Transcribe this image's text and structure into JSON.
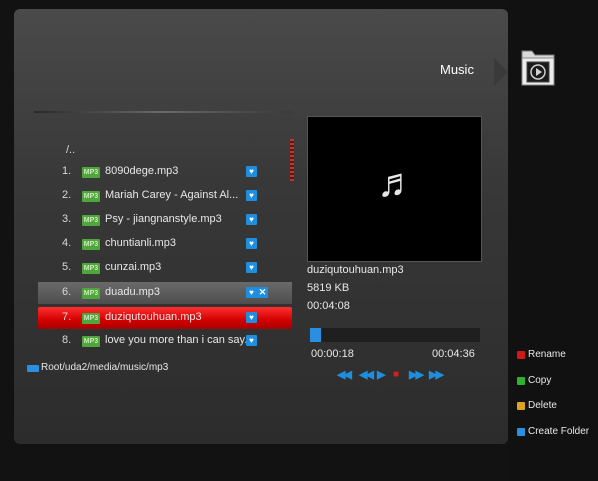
{
  "header": {
    "title": "Music",
    "icon": "music-folder-icon"
  },
  "file_list": {
    "parent": "/..",
    "items": [
      {
        "num": "1.",
        "type": "MP3",
        "name": "8090dege.mp3",
        "fav": true,
        "del": false,
        "state": "normal"
      },
      {
        "num": "2.",
        "type": "MP3",
        "name": "Mariah Carey - Against Al...",
        "fav": true,
        "del": false,
        "state": "normal"
      },
      {
        "num": "3.",
        "type": "MP3",
        "name": "Psy - jiangnanstyle.mp3",
        "fav": true,
        "del": false,
        "state": "normal"
      },
      {
        "num": "4.",
        "type": "MP3",
        "name": "chuntianli.mp3",
        "fav": true,
        "del": false,
        "state": "normal"
      },
      {
        "num": "5.",
        "type": "MP3",
        "name": "cunzai.mp3",
        "fav": true,
        "del": false,
        "state": "normal"
      },
      {
        "num": "6.",
        "type": "MP3",
        "name": "duadu.mp3",
        "fav": true,
        "del": true,
        "state": "selected"
      },
      {
        "num": "7.",
        "type": "MP3",
        "name": "duziqutouhuan.mp3",
        "fav": true,
        "del": false,
        "state": "highlighted"
      },
      {
        "num": "8.",
        "type": "MP3",
        "name": "love you more than i can say.",
        "fav": true,
        "del": false,
        "state": "normal"
      }
    ]
  },
  "path": {
    "text": "Root/uda2/media/music/mp3"
  },
  "player": {
    "file_name": "duziqutouhuan.mp3",
    "file_size": "5819 KB",
    "duration": "00:04:08",
    "current_time": "00:00:18",
    "total_time": "00:04:36",
    "progress_fraction": 0.065
  },
  "controls": [
    "rewind-fast",
    "rewind",
    "play",
    "stop",
    "forward",
    "forward-fast"
  ],
  "legend": [
    {
      "color": "#d01818",
      "label": "Rename"
    },
    {
      "color": "#2fb02f",
      "label": "Copy"
    },
    {
      "color": "#e0a020",
      "label": "Delete"
    },
    {
      "color": "#2a8fe0",
      "label": "Create Folder"
    }
  ]
}
